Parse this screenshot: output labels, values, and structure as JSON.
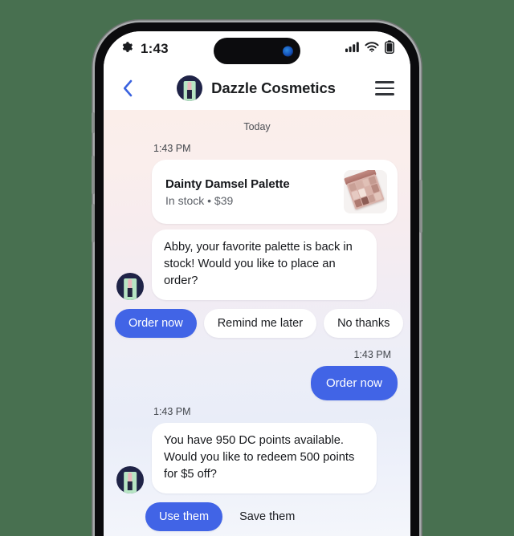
{
  "theme": {
    "page_background": "#487050",
    "accent_blue": "#4164e6",
    "brand_navy": "#1f2347",
    "brand_mint": "#b7e5c4"
  },
  "status_bar": {
    "time": "1:43",
    "left_icon": "gear-icon",
    "icons": [
      "cellular-signal-icon",
      "wifi-icon",
      "battery-icon"
    ]
  },
  "nav_bar": {
    "back_icon": "chevron-left-icon",
    "brand_name": "Dazzle Cosmetics",
    "menu_icon": "hamburger-menu-icon"
  },
  "chat": {
    "day_divider": "Today",
    "messages": [
      {
        "timestamp": "1:43 PM",
        "type": "product_card",
        "title": "Dainty Damsel Palette",
        "meta": "In stock • $39",
        "thumb_alt": "eyeshadow-palette-photo"
      },
      {
        "type": "bot_text",
        "text": "Abby, your favorite palette is back in stock! Would you like to place an order?"
      }
    ],
    "quick_replies_1": [
      {
        "label": "Order now",
        "primary": true
      },
      {
        "label": "Remind me later",
        "primary": false
      },
      {
        "label": "No thanks",
        "primary": false
      }
    ],
    "user_message": {
      "timestamp": "1:43 PM",
      "text": "Order now"
    },
    "points_message": {
      "timestamp": "1:43 PM",
      "text": "You have 950 DC points available. Would you like to redeem 500 points for $5 off?"
    },
    "quick_replies_2": [
      {
        "label": "Use them",
        "primary": true
      },
      {
        "label": "Save them",
        "primary": false
      }
    ]
  }
}
